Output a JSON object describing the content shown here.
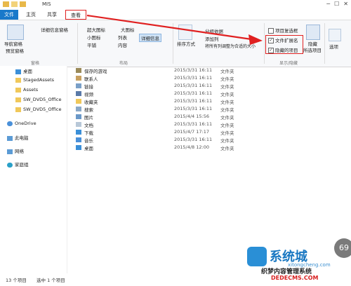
{
  "window": {
    "title": "MIS"
  },
  "tabs": {
    "file": "文件",
    "home": "主页",
    "share": "共享",
    "view": "查看"
  },
  "ribbon": {
    "details_pane": "详细信息窗格",
    "nav_pane": "导航窗格",
    "preview_pane": "预览窗格",
    "pane_group": "窗格",
    "extra_large_icons": "超大图标",
    "large_icons": "大图标",
    "small_icons": "小图标",
    "list": "列表",
    "tiles": "平铺",
    "content": "内容",
    "details": "详细信息",
    "layout_group": "布局",
    "sort_by": "排序方式",
    "group_by": "分组依据",
    "add_columns": "添加列",
    "size_all_columns": "将所有列调整为合适的大小",
    "item_checkboxes": "项目复选框",
    "file_extensions": "文件扩展名",
    "hidden_items": "隐藏的项目",
    "hide_selected": "隐藏",
    "hide_selected_2": "所选项目",
    "show_hide_group": "显示/隐藏",
    "options": "选项"
  },
  "nav": {
    "items": [
      "桌面",
      "StagedAssets",
      "Assets",
      "SW_DVD5_Office",
      "SW_DVD5_Office",
      "OneDrive",
      "此电脑",
      "网络",
      "家庭组"
    ]
  },
  "files": [
    {
      "name": "保存的游戏",
      "date": "2015/3/31 16:11",
      "type": "文件夹"
    },
    {
      "name": "联系人",
      "date": "2015/3/31 16:11",
      "type": "文件夹"
    },
    {
      "name": "链接",
      "date": "2015/3/31 16:11",
      "type": "文件夹"
    },
    {
      "name": "视频",
      "date": "2015/3/31 16:11",
      "type": "文件夹"
    },
    {
      "name": "收藏夹",
      "date": "2015/3/31 16:11",
      "type": "文件夹"
    },
    {
      "name": "搜索",
      "date": "2015/3/31 16:11",
      "type": "文件夹"
    },
    {
      "name": "图片",
      "date": "2015/4/4 15:56",
      "type": "文件夹"
    },
    {
      "name": "文档",
      "date": "2015/3/31 16:11",
      "type": "文件夹"
    },
    {
      "name": "下载",
      "date": "2015/4/7 17:17",
      "type": "文件夹"
    },
    {
      "name": "音乐",
      "date": "2015/3/31 16:11",
      "type": "文件夹"
    },
    {
      "name": "桌面",
      "date": "2015/4/8 12:00",
      "type": "文件夹"
    }
  ],
  "status": {
    "count": "13 个项目",
    "selected": "选中 1 个项目"
  },
  "watermark": {
    "text1": "系统城",
    "url1": "xitongcheng.com",
    "text2": "织梦内容管理系统",
    "url2": "DEDECMS.COM",
    "badge": "69"
  },
  "colors": {
    "accent": "#1979ca",
    "highlight": "#e02020"
  }
}
